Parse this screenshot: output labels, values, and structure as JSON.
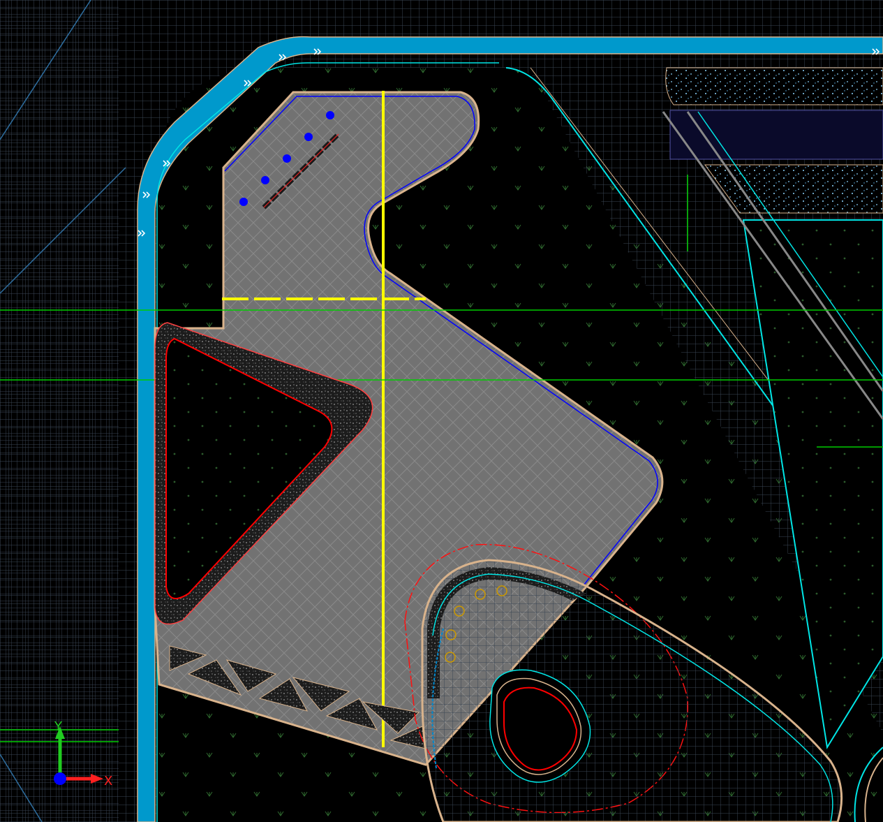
{
  "viewport": {
    "background": "#000000",
    "grid_color": "#3a4654",
    "accent_colors": {
      "water_channel": "#0099cc",
      "boundary_cyan": "#00e5e5",
      "paved_area": "#707070",
      "centerline": "#ffff00",
      "red_outline": "#ff0000",
      "blue_outline": "#0000ff",
      "green_line": "#00cc00",
      "tan_edge": "#d9b38c",
      "flow_marker": "#ffffff",
      "point_marker": "#0000ff",
      "speckle_fill": "#8fd6ff",
      "circle_marker": "#cc9900"
    }
  },
  "ucs_icon": {
    "x_label": "X",
    "y_label": "Y",
    "x_color": "#ff2020",
    "y_color": "#20cc20",
    "origin_color": "#0000ff"
  },
  "layers": {
    "channel": "water-channel",
    "pad": "paved-pad",
    "planting": "planting-bed"
  }
}
